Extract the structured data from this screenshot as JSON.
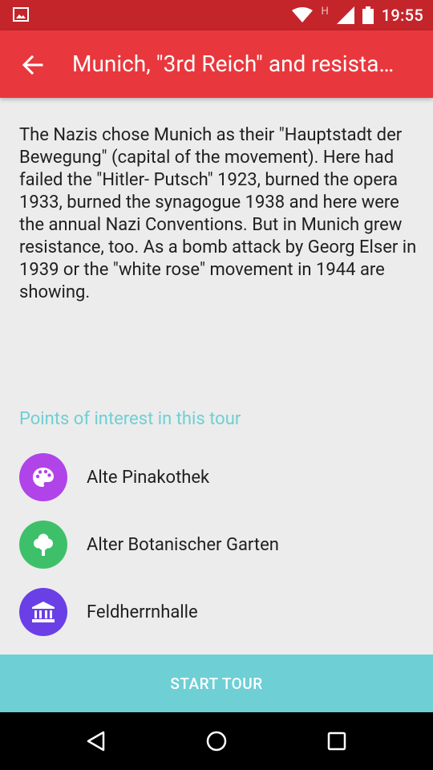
{
  "status_bar": {
    "time": "19:55",
    "network_letter": "H",
    "icons": [
      "image-notification-icon",
      "wifi-icon",
      "signal-icon",
      "battery-icon"
    ]
  },
  "toolbar": {
    "title": "Munich, \"3rd Reich\" and resista…",
    "back_icon": "arrow-left-icon",
    "color": "#e8383d"
  },
  "description": "The Nazis chose Munich as their \"Hauptstadt der Bewegung\" (capital of the movement). Here had failed the \"Hitler- Putsch\" 1923, burned the opera 1933, burned the synagogue 1938 and here were the annual Nazi Conventions. But in Munich grew resistance, too. As a bomb attack by Georg Elser in 1939 or the \"white rose\" movement in 1944 are showing.",
  "poi_section": {
    "title": "Points of interest in this tour",
    "items": [
      {
        "label": "Alte Pinakothek",
        "icon": "palette-icon",
        "color": "#b044e8"
      },
      {
        "label": "Alter Botanischer Garten",
        "icon": "tree-icon",
        "color": "#3ec06a"
      },
      {
        "label": "Feldherrnhalle",
        "icon": "museum-icon",
        "color": "#6a3fe6"
      }
    ]
  },
  "start_button": {
    "label": "START TOUR",
    "color": "#6ecfd5"
  },
  "nav_bar": {
    "buttons": [
      "back-triangle-icon",
      "home-circle-icon",
      "recents-square-icon"
    ]
  }
}
